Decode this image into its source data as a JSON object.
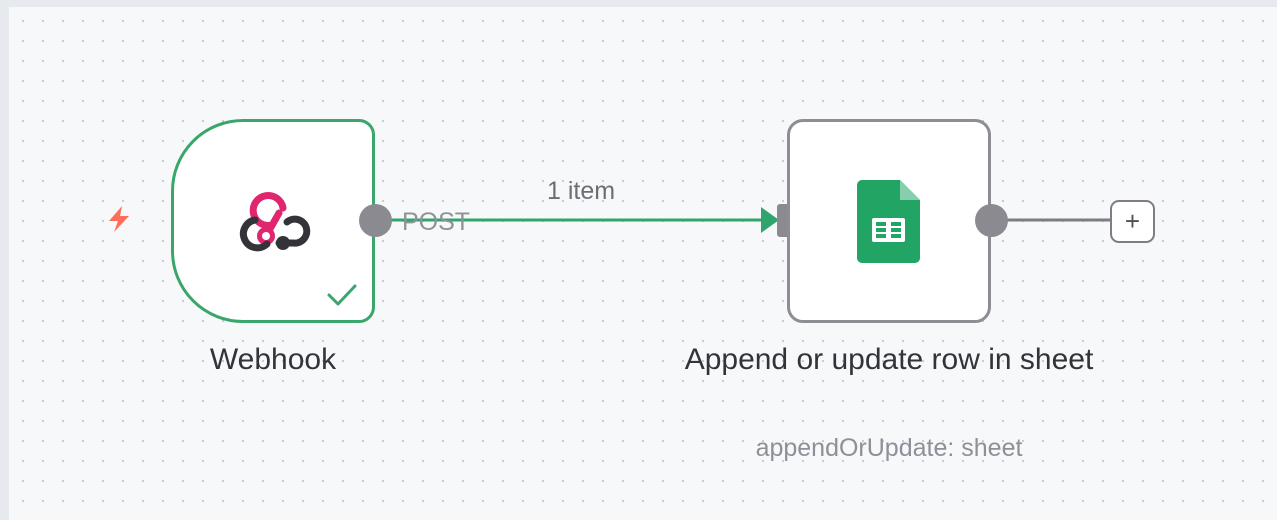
{
  "workflow": {
    "nodes": [
      {
        "name": "Webhook",
        "subtitle": "",
        "icon": "webhook-icon",
        "status": "success",
        "output_label": "POST",
        "color": "#3aa66b"
      },
      {
        "name": "Append or update row in sheet",
        "subtitle": "appendOrUpdate: sheet",
        "icon": "google-sheets-icon",
        "color": "#8d8d93"
      }
    ],
    "connection": {
      "label": "1 item",
      "color": "#30a46c"
    },
    "add_button_label": "+",
    "trigger_icon": "lightning-bolt-icon",
    "trigger_color": "#ff6d5a"
  }
}
